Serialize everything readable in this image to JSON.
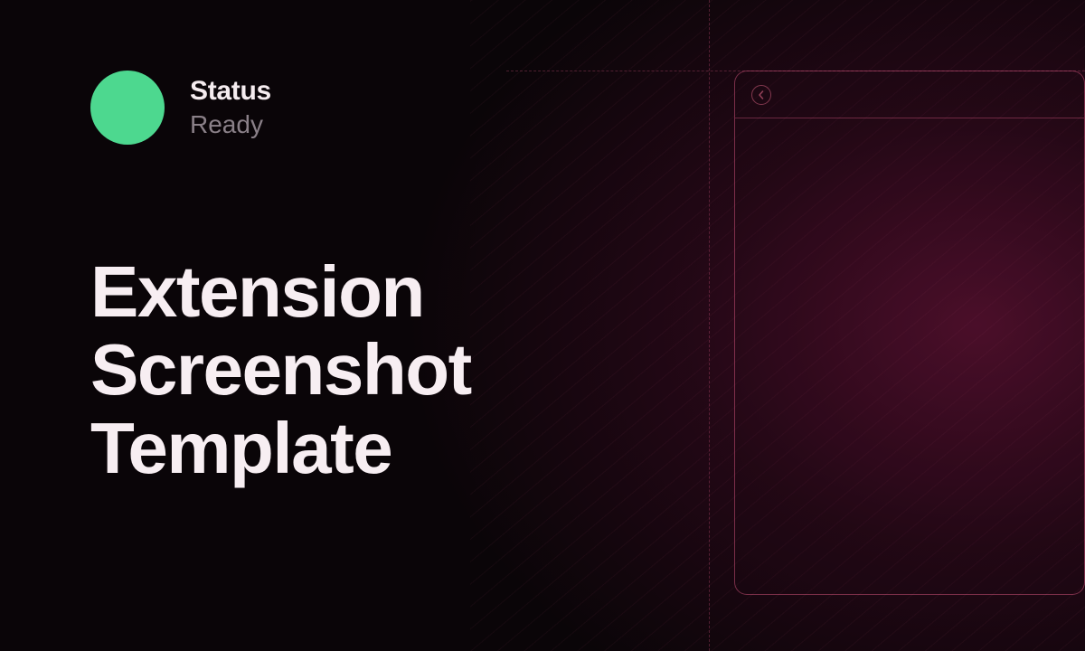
{
  "status": {
    "label": "Status",
    "value": "Ready",
    "dot_color": "#4dd88f"
  },
  "title": {
    "line1": "Extension",
    "line2": "Screenshot",
    "line3": "Template"
  },
  "colors": {
    "accent": "#c85078",
    "background": "#0a0508"
  }
}
